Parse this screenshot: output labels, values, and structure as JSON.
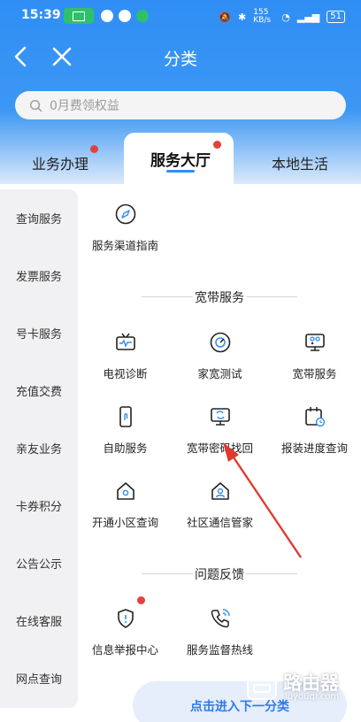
{
  "status_bar": {
    "time": "15:39",
    "net_speed": "155 KB/s",
    "battery": "51"
  },
  "header": {
    "title": "分类",
    "search_placeholder": "0月费领权益"
  },
  "tabs": [
    {
      "label": "业务办理",
      "dot": true
    },
    {
      "label": "服务大厅",
      "active": true,
      "dot": true
    },
    {
      "label": "本地生活"
    }
  ],
  "sidebar": [
    "查询服务",
    "发票服务",
    "号卡服务",
    "充值交费",
    "亲友业务",
    "卡券积分",
    "公告公示",
    "在线客服",
    "网点查询"
  ],
  "top_service": {
    "label": "服务渠道指南",
    "icon": "compass-icon"
  },
  "sections": [
    {
      "title": "宽带服务",
      "items": [
        {
          "label": "电视诊断",
          "icon": "tv-diagnose-icon"
        },
        {
          "label": "家宽测试",
          "icon": "speed-test-icon"
        },
        {
          "label": "宽带服务",
          "icon": "broadband-icon"
        },
        {
          "label": "自助服务",
          "icon": "phone-touch-icon"
        },
        {
          "label": "宽带密码找回",
          "icon": "password-recover-icon"
        },
        {
          "label": "报装进度查询",
          "icon": "calendar-clock-icon"
        },
        {
          "label": "开通小区查询",
          "icon": "house-icon"
        },
        {
          "label": "社区通信管家",
          "icon": "house-person-icon"
        }
      ]
    },
    {
      "title": "问题反馈",
      "items": [
        {
          "label": "信息举报中心",
          "icon": "shield-alert-icon",
          "dot": true
        },
        {
          "label": "服务监督热线",
          "icon": "phone-call-icon"
        }
      ]
    }
  ],
  "floating_button": "点击进入下一分类",
  "watermark": {
    "text": "路由器",
    "url": "luyouqi.com"
  },
  "colors": {
    "brand_blue": "#2f8ef5",
    "badge_red": "#e2423b",
    "arrow_red": "#e03a2f"
  }
}
